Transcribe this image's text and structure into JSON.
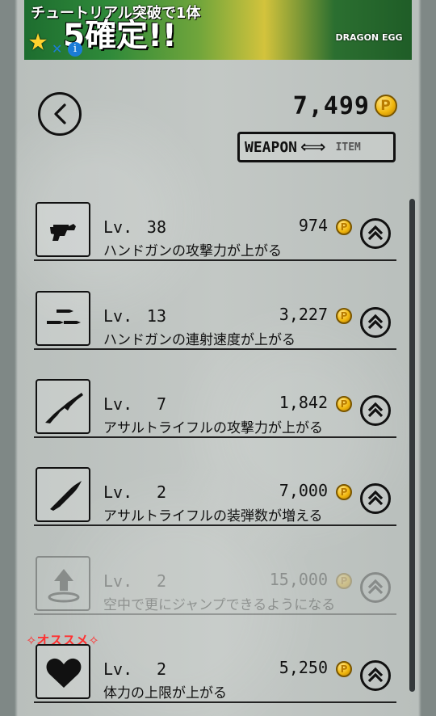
{
  "ad": {
    "top_text": "チュートリアル突破で1体",
    "main_text": "5確定!!",
    "brand_text": "DRAGON EGG"
  },
  "header": {
    "back_icon": "back-arrow-icon",
    "coins": "7,499"
  },
  "switcher": {
    "left": "WEAPON",
    "right": "ITEM",
    "arrow": "⟺"
  },
  "recommend_label": "✧オススメ✧",
  "items": [
    {
      "level_label": "Lv.",
      "level": "38",
      "cost": "974",
      "description": "ハンドガンの攻撃力が上がる",
      "icon": "handgun-icon",
      "enabled": true
    },
    {
      "level_label": "Lv.",
      "level": "13",
      "cost": "3,227",
      "description": "ハンドガンの連射速度が上がる",
      "icon": "bullets-icon",
      "enabled": true
    },
    {
      "level_label": "Lv.",
      "level": "7",
      "cost": "1,842",
      "description": "アサルトライフルの攻撃力が上がる",
      "icon": "assault-rifle-icon",
      "enabled": true
    },
    {
      "level_label": "Lv.",
      "level": "2",
      "cost": "7,000",
      "description": "アサルトライフルの装弾数が増える",
      "icon": "bullet-icon",
      "enabled": true
    },
    {
      "level_label": "Lv.",
      "level": "2",
      "cost": "15,000",
      "description": "空中で更にジャンプできるようになる",
      "icon": "jump-icon",
      "enabled": false
    },
    {
      "level_label": "Lv.",
      "level": "2",
      "cost": "5,250",
      "description": "体力の上限が上がる",
      "icon": "heart-icon",
      "enabled": true
    }
  ]
}
